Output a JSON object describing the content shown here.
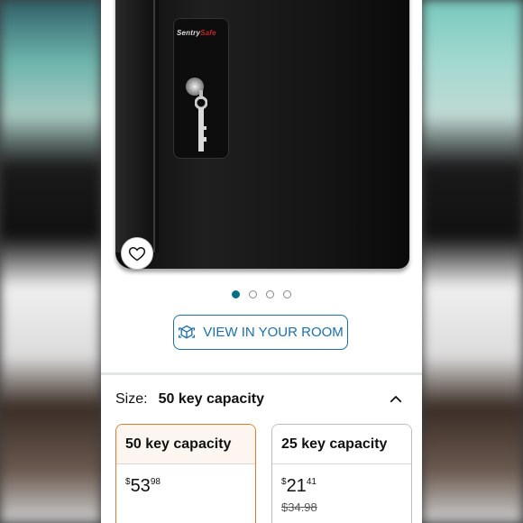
{
  "product": {
    "brand_logo_left": "Sentry",
    "brand_logo_right": "Safe"
  },
  "carousel": {
    "dot_count": 4,
    "active_index": 0
  },
  "view_room": {
    "label": "VIEW IN YOUR ROOM",
    "icon": "ar-cube-icon"
  },
  "size": {
    "label": "Size:",
    "selected": "50 key capacity",
    "options": [
      {
        "name": "50 key capacity",
        "price_symbol": "$",
        "price_whole": "53",
        "price_fraction": "98",
        "list_price": ""
      },
      {
        "name": "25 key capacity",
        "price_symbol": "$",
        "price_whole": "21",
        "price_fraction": "41",
        "list_price": "$34.98"
      }
    ]
  },
  "colors": {
    "accent": "#007185",
    "link": "#1e6fa8",
    "selected_border": "#e07b2c"
  }
}
